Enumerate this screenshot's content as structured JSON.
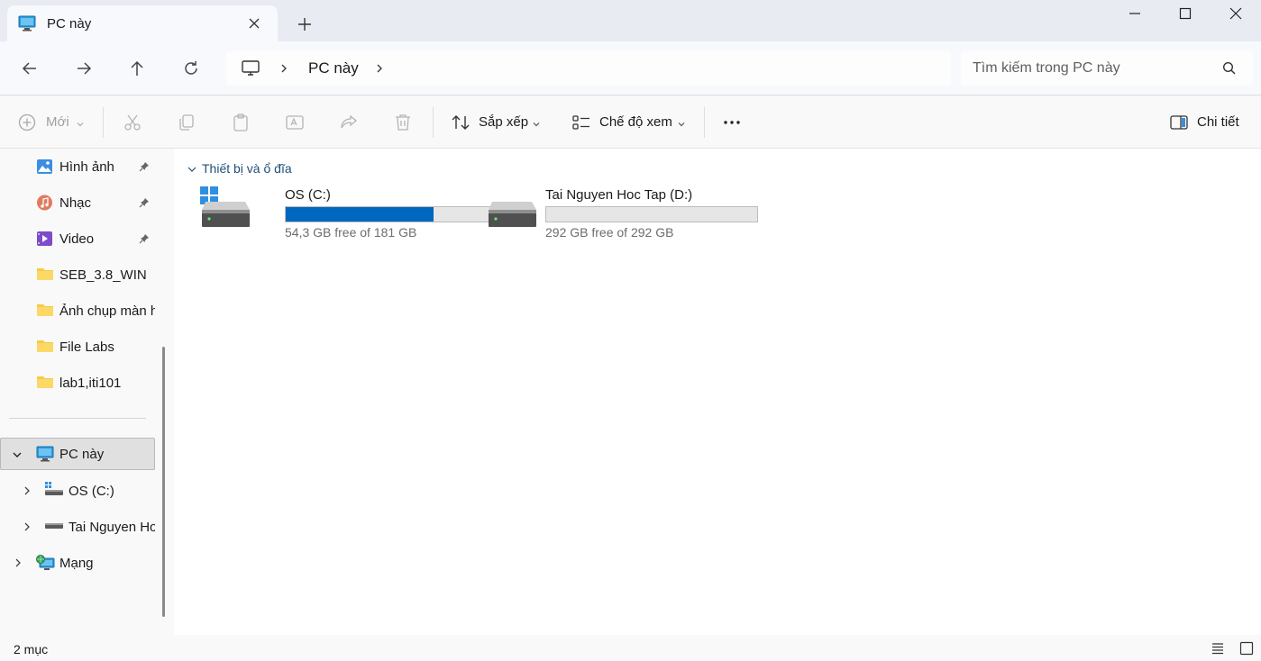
{
  "tab": {
    "title": "PC này"
  },
  "address": {
    "crumb": "PC này"
  },
  "search": {
    "placeholder": "Tìm kiếm trong PC này"
  },
  "toolbar": {
    "new_label": "Mới",
    "sort_label": "Sắp xếp",
    "view_label": "Chế độ xem",
    "details_label": "Chi tiết"
  },
  "sidebar": {
    "quick_access": [
      {
        "label": "Hình ảnh",
        "icon": "pictures-icon",
        "pinned": true
      },
      {
        "label": "Nhạc",
        "icon": "music-icon",
        "pinned": true
      },
      {
        "label": "Video",
        "icon": "video-icon",
        "pinned": true
      },
      {
        "label": "SEB_3.8_WIN",
        "icon": "folder-icon"
      },
      {
        "label": "Ảnh chụp màn hình",
        "icon": "folder-icon"
      },
      {
        "label": "File Labs",
        "icon": "folder-icon"
      },
      {
        "label": "lab1,iti101",
        "icon": "folder-icon"
      }
    ],
    "this_pc": "PC này",
    "drive_c": "OS (C:)",
    "drive_d": "Tai Nguyen Hoc Tap (D:)",
    "network": "Mạng"
  },
  "content": {
    "group_label": "Thiết bị và ổ đĩa",
    "drives": [
      {
        "name": "OS (C:)",
        "free_text": "54,3 GB free of 181 GB",
        "used_fraction": 0.7
      },
      {
        "name": "Tai Nguyen Hoc Tap (D:)",
        "free_text": "292 GB free of 292 GB",
        "used_fraction": 0.0
      }
    ]
  },
  "status": {
    "count": "2 mục"
  },
  "colors": {
    "accent": "#0067c0",
    "folder": "#f8c94a"
  }
}
